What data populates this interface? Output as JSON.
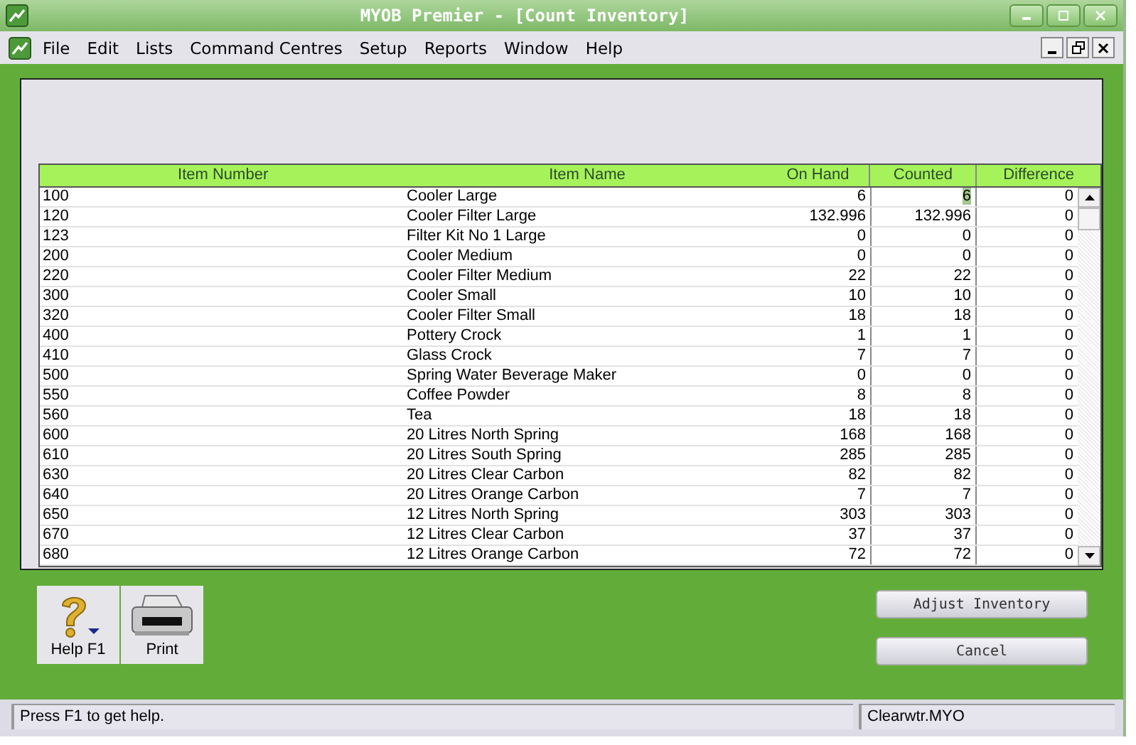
{
  "window": {
    "title": "MYOB Premier - [Count Inventory]"
  },
  "menu": [
    "File",
    "Edit",
    "Lists",
    "Command Centres",
    "Setup",
    "Reports",
    "Window",
    "Help"
  ],
  "table": {
    "columns": [
      "Item Number",
      "Item Name",
      "On Hand",
      "Counted",
      "Difference"
    ],
    "rows": [
      {
        "number": "100",
        "name": "Cooler Large",
        "on_hand": "6",
        "counted": "6",
        "difference": "0",
        "selected": true
      },
      {
        "number": "120",
        "name": "Cooler Filter Large",
        "on_hand": "132.996",
        "counted": "132.996",
        "difference": "0",
        "selected": false
      },
      {
        "number": "123",
        "name": "Filter Kit No 1 Large",
        "on_hand": "0",
        "counted": "0",
        "difference": "0",
        "selected": false
      },
      {
        "number": "200",
        "name": "Cooler Medium",
        "on_hand": "0",
        "counted": "0",
        "difference": "0",
        "selected": false
      },
      {
        "number": "220",
        "name": "Cooler Filter Medium",
        "on_hand": "22",
        "counted": "22",
        "difference": "0",
        "selected": false
      },
      {
        "number": "300",
        "name": "Cooler Small",
        "on_hand": "10",
        "counted": "10",
        "difference": "0",
        "selected": false
      },
      {
        "number": "320",
        "name": "Cooler Filter Small",
        "on_hand": "18",
        "counted": "18",
        "difference": "0",
        "selected": false
      },
      {
        "number": "400",
        "name": "Pottery Crock",
        "on_hand": "1",
        "counted": "1",
        "difference": "0",
        "selected": false
      },
      {
        "number": "410",
        "name": "Glass Crock",
        "on_hand": "7",
        "counted": "7",
        "difference": "0",
        "selected": false
      },
      {
        "number": "500",
        "name": "Spring Water Beverage Maker",
        "on_hand": "0",
        "counted": "0",
        "difference": "0",
        "selected": false
      },
      {
        "number": "550",
        "name": "Coffee Powder",
        "on_hand": "8",
        "counted": "8",
        "difference": "0",
        "selected": false
      },
      {
        "number": "560",
        "name": "Tea",
        "on_hand": "18",
        "counted": "18",
        "difference": "0",
        "selected": false
      },
      {
        "number": "600",
        "name": "20 Litres North Spring",
        "on_hand": "168",
        "counted": "168",
        "difference": "0",
        "selected": false
      },
      {
        "number": "610",
        "name": "20 Litres South Spring",
        "on_hand": "285",
        "counted": "285",
        "difference": "0",
        "selected": false
      },
      {
        "number": "630",
        "name": "20 Litres Clear Carbon",
        "on_hand": "82",
        "counted": "82",
        "difference": "0",
        "selected": false
      },
      {
        "number": "640",
        "name": "20 Litres Orange Carbon",
        "on_hand": "7",
        "counted": "7",
        "difference": "0",
        "selected": false
      },
      {
        "number": "650",
        "name": "12 Litres North Spring",
        "on_hand": "303",
        "counted": "303",
        "difference": "0",
        "selected": false
      },
      {
        "number": "670",
        "name": "12 Litres Clear Carbon",
        "on_hand": "37",
        "counted": "37",
        "difference": "0",
        "selected": false
      },
      {
        "number": "680",
        "name": "12 Litres Orange Carbon",
        "on_hand": "72",
        "counted": "72",
        "difference": "0",
        "selected": false
      }
    ]
  },
  "toolbar": [
    {
      "kind": "help",
      "label": "Help F1"
    },
    {
      "kind": "print",
      "label": "Print"
    }
  ],
  "buttons": [
    "Adjust Inventory",
    "Cancel"
  ],
  "status_bar": {
    "hint": "Press F1 to get help.",
    "file": "Clearwtr.MYO"
  }
}
